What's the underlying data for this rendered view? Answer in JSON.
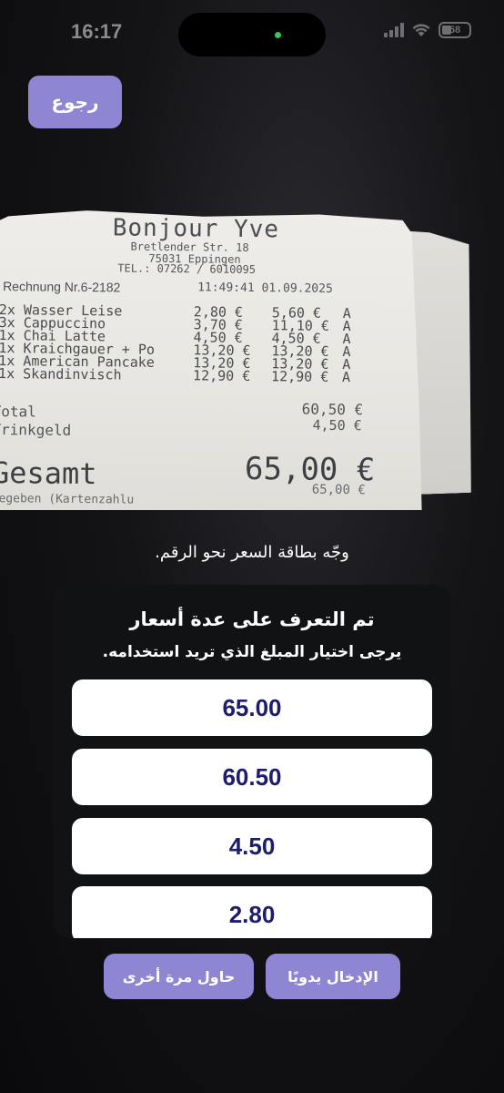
{
  "status_bar": {
    "time": "16:17",
    "battery": "58"
  },
  "header": {
    "back_label": "رجوع"
  },
  "receipt": {
    "shop": "Bonjour Yve",
    "address_line1": "Bretlender Str. 18",
    "address_line2": "75031 Eppingen",
    "phone": "TEL.: 07262 / 6010095",
    "invoice": "Rechnung Nr.6-2182",
    "datetime": "11:49:41 01.09.2025",
    "items": [
      {
        "name": "2x Wasser Leise",
        "price": "2,80 €",
        "total": "5,60 €",
        "tax": "A"
      },
      {
        "name": "3x Cappuccino",
        "price": "3,70 €",
        "total": "11,10 €",
        "tax": "A"
      },
      {
        "name": "1x Chai Latte",
        "price": "4,50 €",
        "total": "4,50 €",
        "tax": "A"
      },
      {
        "name": "1x Kraichgauer + Po",
        "price": "13,20 €",
        "total": "13,20 €",
        "tax": "A"
      },
      {
        "name": "1x American Pancake",
        "price": "13,20 €",
        "total": "13,20 €",
        "tax": "A"
      },
      {
        "name": "1x Skandinvisch",
        "price": "12,90 €",
        "total": "12,90 €",
        "tax": "A"
      }
    ],
    "total_label": "Total",
    "total_value": "60,50 €",
    "tip_label": "Trinkgeld",
    "tip_value": "4,50 €",
    "gesamt_label": "Gesamt",
    "gesamt_value": "65,00 €",
    "given_label": "Gegeben (Kartenzahlu",
    "given_value": "65,00 €"
  },
  "hint": "وجّه بطاقة السعر نحو الرقم.",
  "panel": {
    "title": "تم التعرف على عدة أسعار",
    "subtitle": "يرجى اختيار المبلغ الذي تريد استخدامه.",
    "amounts": [
      "65.00",
      "60.50",
      "4.50",
      "2.80"
    ]
  },
  "actions": {
    "retry_label": "حاول مرة أخرى",
    "manual_label": "الإدخال يدويًا"
  }
}
